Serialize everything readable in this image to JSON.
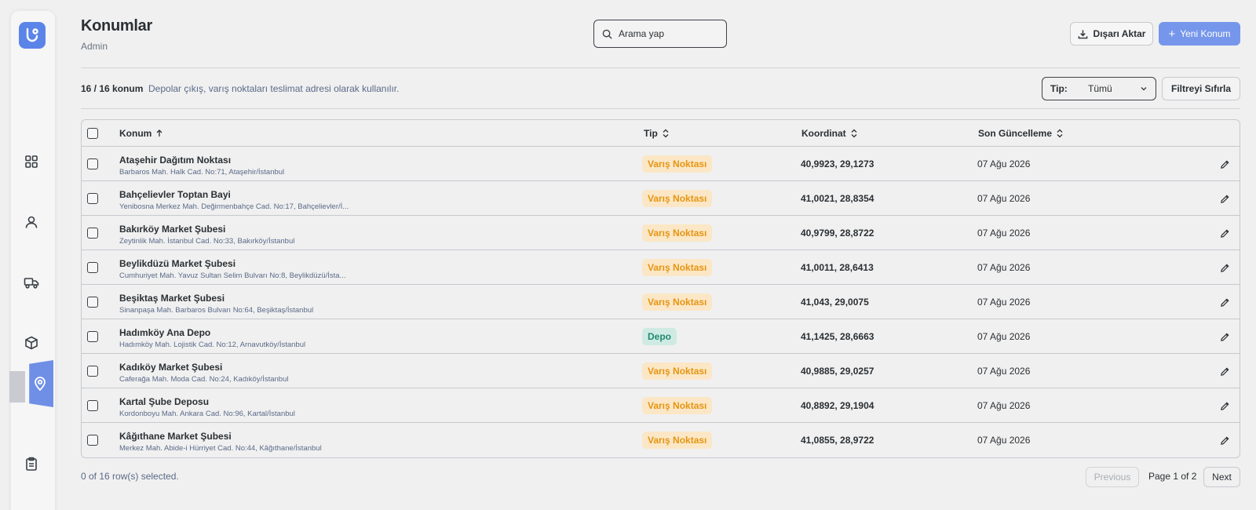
{
  "header": {
    "title": "Konumlar",
    "subtitle": "Admin"
  },
  "search": {
    "placeholder": "Arama yap"
  },
  "actions": {
    "export_label": "Dışarı Aktar",
    "new_label": "Yeni Konum",
    "new_prefix": "+"
  },
  "filters": {
    "count_label": "16 / 16 konum",
    "hint": "Depolar çıkış, varış noktaları teslimat adresi olarak kullanılır.",
    "type_label": "Tip:",
    "type_value": "Tümü",
    "reset_label": "Filtreyi Sıfırla"
  },
  "table": {
    "columns": [
      "Konum",
      "Tip",
      "Koordinat",
      "Son Güncelleme"
    ],
    "rows": [
      {
        "name": "Ataşehir Dağıtım Noktası",
        "address": "Barbaros Mah. Halk Cad. No:71, Ataşehir/İstanbul",
        "type": "Varış Noktası",
        "coord": "40,9923, 29,1273",
        "updated": "07 Ağu 2026"
      },
      {
        "name": "Bahçelievler Toptan Bayi",
        "address": "Yenibosna Merkez Mah. Değirmenbahçe Cad. No:17, Bahçelievler/İ...",
        "type": "Varış Noktası",
        "coord": "41,0021, 28,8354",
        "updated": "07 Ağu 2026"
      },
      {
        "name": "Bakırköy Market Şubesi",
        "address": "Zeytinlik Mah. İstanbul Cad. No:33, Bakırköy/İstanbul",
        "type": "Varış Noktası",
        "coord": "40,9799, 28,8722",
        "updated": "07 Ağu 2026"
      },
      {
        "name": "Beylikdüzü Market Şubesi",
        "address": "Cumhuriyet Mah. Yavuz Sultan Selim Bulvarı No:8, Beylikdüzü/İsta...",
        "type": "Varış Noktası",
        "coord": "41,0011, 28,6413",
        "updated": "07 Ağu 2026"
      },
      {
        "name": "Beşiktaş Market Şubesi",
        "address": "Sinanpaşa Mah. Barbaros Bulvarı No:64, Beşiktaş/İstanbul",
        "type": "Varış Noktası",
        "coord": "41,043, 29,0075",
        "updated": "07 Ağu 2026"
      },
      {
        "name": "Hadımköy Ana Depo",
        "address": "Hadımköy Mah. Lojistik Cad. No:12, Arnavutköy/İstanbul",
        "type": "Depo",
        "coord": "41,1425, 28,6663",
        "updated": "07 Ağu 2026"
      },
      {
        "name": "Kadıköy Market Şubesi",
        "address": "Caferağa Mah. Moda Cad. No:24, Kadıköy/İstanbul",
        "type": "Varış Noktası",
        "coord": "40,9885, 29,0257",
        "updated": "07 Ağu 2026"
      },
      {
        "name": "Kartal Şube Deposu",
        "address": "Kordonboyu Mah. Ankara Cad. No:96, Kartal/İstanbul",
        "type": "Varış Noktası",
        "coord": "40,8892, 29,1904",
        "updated": "07 Ağu 2026"
      },
      {
        "name": "Kâğıthane Market Şubesi",
        "address": "Merkez Mah. Abide-i Hürriyet Cad. No:44, Kâğıthane/İstanbul",
        "type": "Varış Noktası",
        "coord": "41,0855, 28,9722",
        "updated": "07 Ağu 2026"
      }
    ]
  },
  "footer": {
    "selected": "0 of 16 row(s) selected.",
    "previous": "Previous",
    "page_info": "Page 1 of 2",
    "next": "Next"
  },
  "colors": {
    "accent": "#7596ea",
    "badge_destination_bg": "#fbe7c6",
    "badge_destination_fg": "#e69512",
    "badge_depot_bg": "#cfeae3",
    "badge_depot_fg": "#1f8a72"
  },
  "icons": {
    "sidebar": [
      "dashboard-icon",
      "user-icon",
      "truck-icon",
      "package-icon",
      "map-pin-icon",
      "clipboard-icon"
    ],
    "search": "search-icon",
    "export": "download-icon",
    "edit": "pencil-icon"
  }
}
